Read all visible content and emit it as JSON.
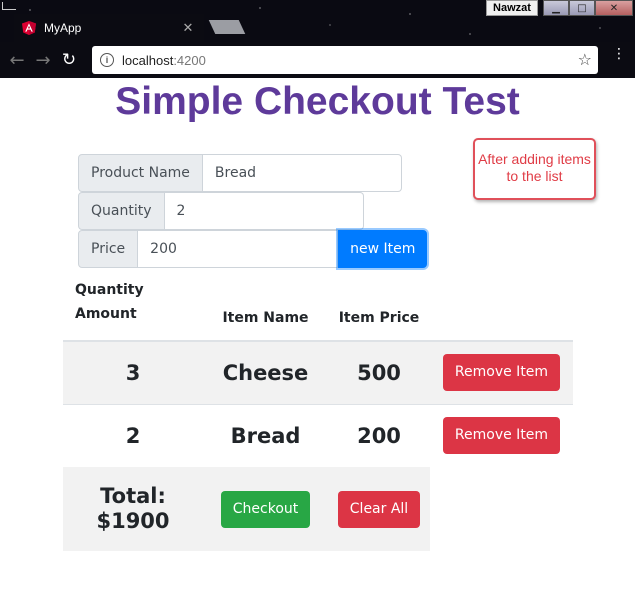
{
  "browser": {
    "tab_title": "MyApp",
    "tab_close": "✕",
    "user_name": "Nawzat",
    "window_controls": {
      "minimize": "▁",
      "maximize": "□",
      "close": "✕"
    },
    "nav": {
      "back": "←",
      "forward": "→",
      "reload": "↻"
    },
    "url_host": "localhost",
    "url_port": ":4200",
    "info_glyph": "i",
    "star_glyph": "☆",
    "menu_glyph": "⋮"
  },
  "page": {
    "title": "Simple Checkout Test",
    "note": "After adding items to the list"
  },
  "form": {
    "product_name_label": "Product Name",
    "product_name_value": "Bread",
    "quantity_label": "Quantity",
    "quantity_value": "2",
    "price_label": "Price",
    "price_value": "200",
    "new_item_label": "new Item"
  },
  "table": {
    "headers": [
      "Quantity Amount",
      "Item Name",
      "Item Price",
      ""
    ],
    "rows": [
      {
        "quantity": "3",
        "name": "Cheese",
        "price": "500",
        "action": "Remove Item"
      },
      {
        "quantity": "2",
        "name": "Bread",
        "price": "200",
        "action": "Remove Item"
      }
    ],
    "total_label": "Total:",
    "total_value": "$1900",
    "checkout_label": "Checkout",
    "clear_all_label": "Clear All"
  },
  "colors": {
    "title": "#5e3a9a",
    "primary": "#007bff",
    "danger": "#dc3545",
    "success": "#28a745",
    "note_border": "#e0505a"
  }
}
